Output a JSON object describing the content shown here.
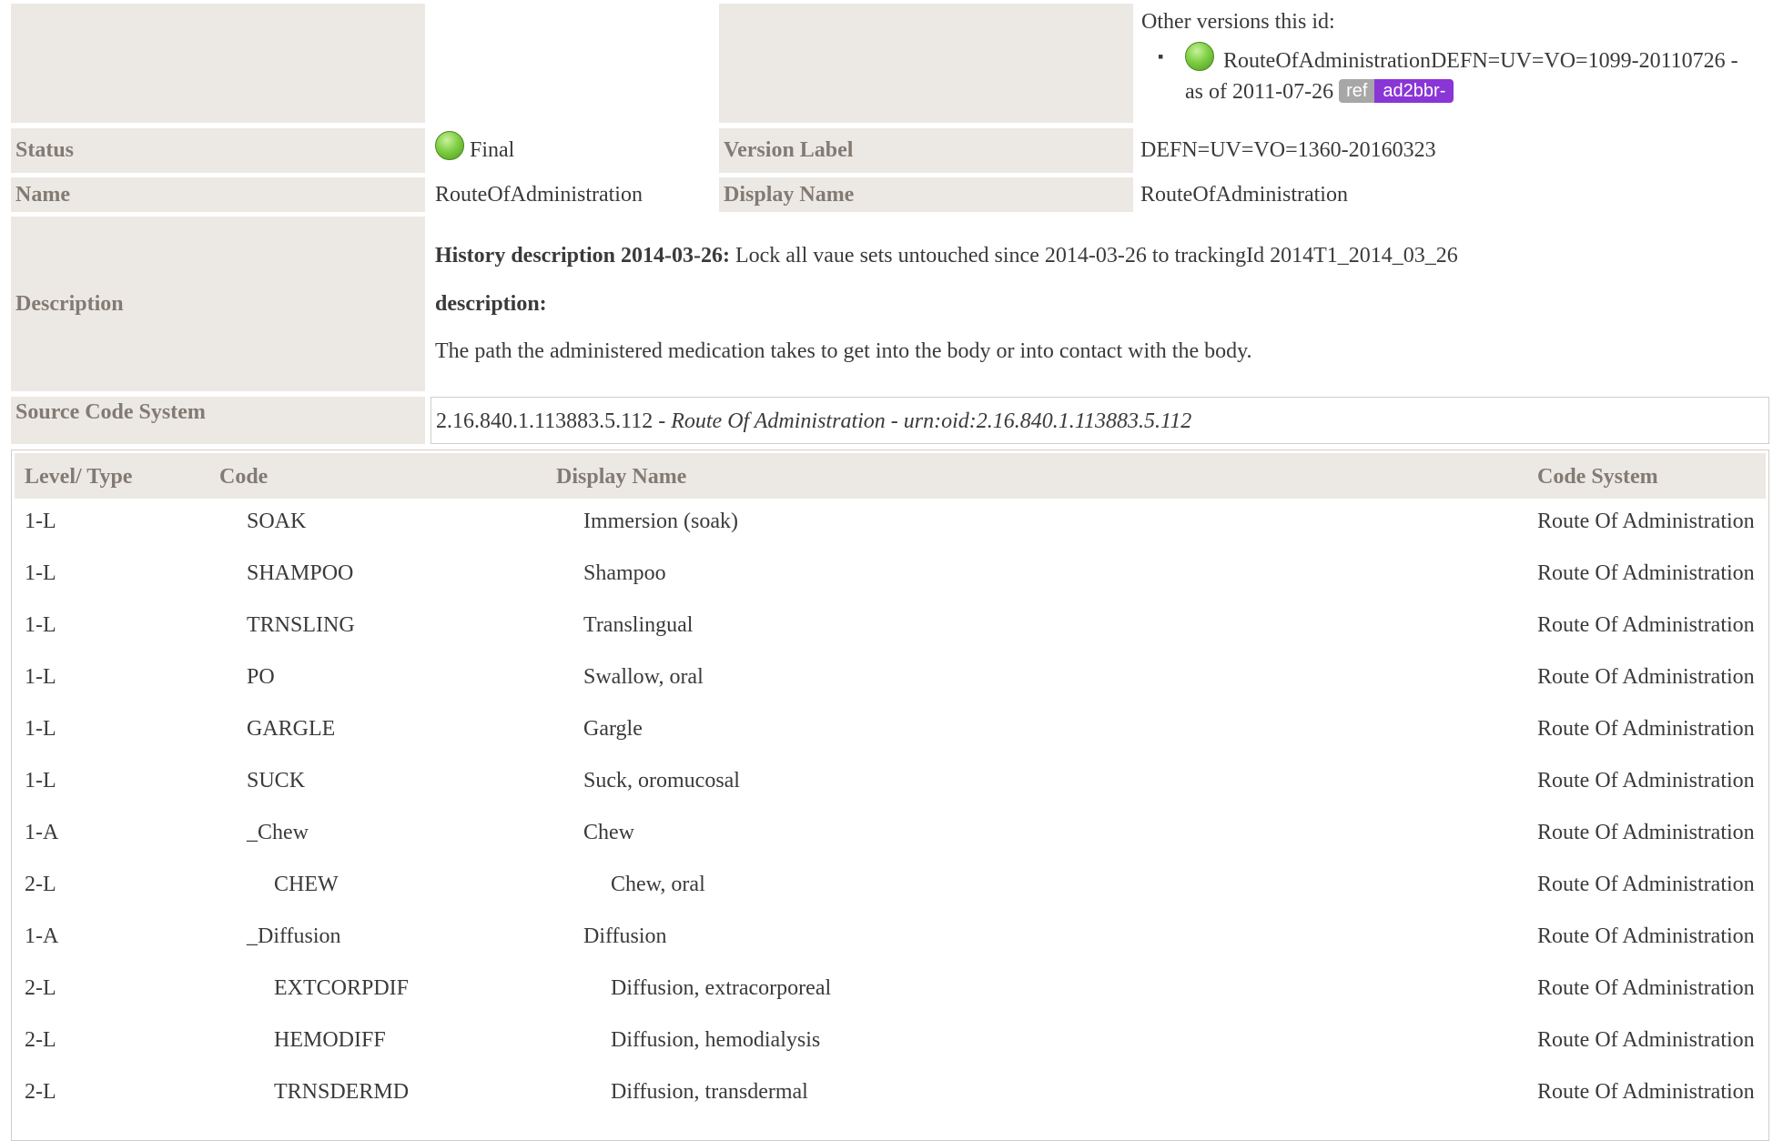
{
  "other_versions": {
    "heading": "Other versions this id:",
    "items": [
      {
        "line1": "RouteOfAdministrationDEFN=UV=VO=1099-20110726 -",
        "line2": "as of 2011-07-26",
        "badge_ref": "ref",
        "badge_id": "ad2bbr-"
      }
    ]
  },
  "status": {
    "label": "Status",
    "value": "Final"
  },
  "version_label": {
    "label": "Version Label",
    "value": "DEFN=UV=VO=1360-20160323"
  },
  "name": {
    "label": "Name",
    "value": "RouteOfAdministration"
  },
  "display_name": {
    "label": "Display Name",
    "value": "RouteOfAdministration"
  },
  "description": {
    "label": "Description",
    "history_title": "History description 2014-03-26:",
    "history_text": " Lock all vaue sets untouched since 2014-03-26 to trackingId 2014T1_2014_03_26",
    "desc_title": "description:",
    "desc_text": "The path the administered medication takes to get into the body or into contact with the body."
  },
  "source_code_system": {
    "label": "Source Code System",
    "oid": "2.16.840.1.113883.5.112",
    "sep1": " - ",
    "name": "Route Of Administration",
    "sep2": " - ",
    "urn": "urn:oid:2.16.840.1.113883.5.112"
  },
  "table": {
    "headers": [
      "Level/ Type",
      "Code",
      "Display Name",
      "Code System"
    ],
    "rows": [
      {
        "level": "1-L",
        "code": "SOAK",
        "display": "Immersion (soak)",
        "system": "Route Of Administration",
        "depth": 1
      },
      {
        "level": "1-L",
        "code": "SHAMPOO",
        "display": "Shampoo",
        "system": "Route Of Administration",
        "depth": 1
      },
      {
        "level": "1-L",
        "code": "TRNSLING",
        "display": "Translingual",
        "system": "Route Of Administration",
        "depth": 1
      },
      {
        "level": "1-L",
        "code": "PO",
        "display": "Swallow, oral",
        "system": "Route Of Administration",
        "depth": 1
      },
      {
        "level": "1-L",
        "code": "GARGLE",
        "display": "Gargle",
        "system": "Route Of Administration",
        "depth": 1
      },
      {
        "level": "1-L",
        "code": "SUCK",
        "display": "Suck, oromucosal",
        "system": "Route Of Administration",
        "depth": 1
      },
      {
        "level": "1-A",
        "code": "_Chew",
        "display": "Chew",
        "system": "Route Of Administration",
        "depth": 1
      },
      {
        "level": "2-L",
        "code": "CHEW",
        "display": "Chew, oral",
        "system": "Route Of Administration",
        "depth": 2
      },
      {
        "level": "1-A",
        "code": "_Diffusion",
        "display": "Diffusion",
        "system": "Route Of Administration",
        "depth": 1
      },
      {
        "level": "2-L",
        "code": "EXTCORPDIF",
        "display": "Diffusion, extracorporeal",
        "system": "Route Of Administration",
        "depth": 2
      },
      {
        "level": "2-L",
        "code": "HEMODIFF",
        "display": "Diffusion, hemodialysis",
        "system": "Route Of Administration",
        "depth": 2
      },
      {
        "level": "2-L",
        "code": "TRNSDERMD",
        "display": "Diffusion, transdermal",
        "system": "Route Of Administration",
        "depth": 2
      }
    ]
  }
}
